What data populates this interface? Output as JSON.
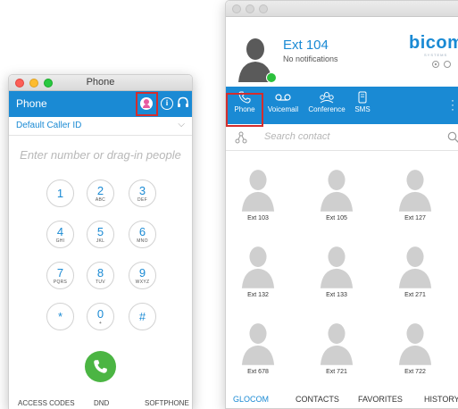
{
  "phone_window": {
    "title": "Phone",
    "header_label": "Phone",
    "caller_id": "Default Caller ID",
    "number_placeholder": "Enter number or drag-in people",
    "keys": [
      {
        "digit": "1",
        "letters": ""
      },
      {
        "digit": "2",
        "letters": "ABC"
      },
      {
        "digit": "3",
        "letters": "DEF"
      },
      {
        "digit": "4",
        "letters": "GHI"
      },
      {
        "digit": "5",
        "letters": "JKL"
      },
      {
        "digit": "6",
        "letters": "MNO"
      },
      {
        "digit": "7",
        "letters": "PQRS"
      },
      {
        "digit": "8",
        "letters": "TUV"
      },
      {
        "digit": "9",
        "letters": "WXYZ"
      },
      {
        "digit": "*",
        "letters": ""
      },
      {
        "digit": "0",
        "letters": "+"
      },
      {
        "digit": "#",
        "letters": ""
      }
    ],
    "footer": {
      "access_codes": "ACCESS CODES",
      "dnd": "DND",
      "softphone": "SOFTPHONE"
    },
    "icons": [
      "avatar-icon",
      "info-icon",
      "headset-icon",
      "chevron-down-icon",
      "phone-handset-icon"
    ]
  },
  "main_window": {
    "ext_name": "Ext 104",
    "notifications": "No notifications",
    "brand": "bicom",
    "brand_sub": "SYSTEMS",
    "nav": [
      {
        "label": "Phone"
      },
      {
        "label": "Voicemail"
      },
      {
        "label": "Conference"
      },
      {
        "label": "SMS"
      }
    ],
    "search_placeholder": "Search contact",
    "contacts": [
      "Ext 103",
      "Ext 105",
      "Ext 127",
      "Ext 132",
      "Ext 133",
      "Ext 271",
      "Ext 678",
      "Ext 721",
      "Ext 722"
    ],
    "tabs": [
      "GLOCOM",
      "CONTACTS",
      "FAVORITES",
      "HISTORY"
    ],
    "active_tab": "GLOCOM"
  },
  "colors": {
    "accent": "#1a8ad4",
    "call_green": "#4bb543",
    "highlight_red": "#d32d2d",
    "presence_green": "#2cc03c"
  }
}
